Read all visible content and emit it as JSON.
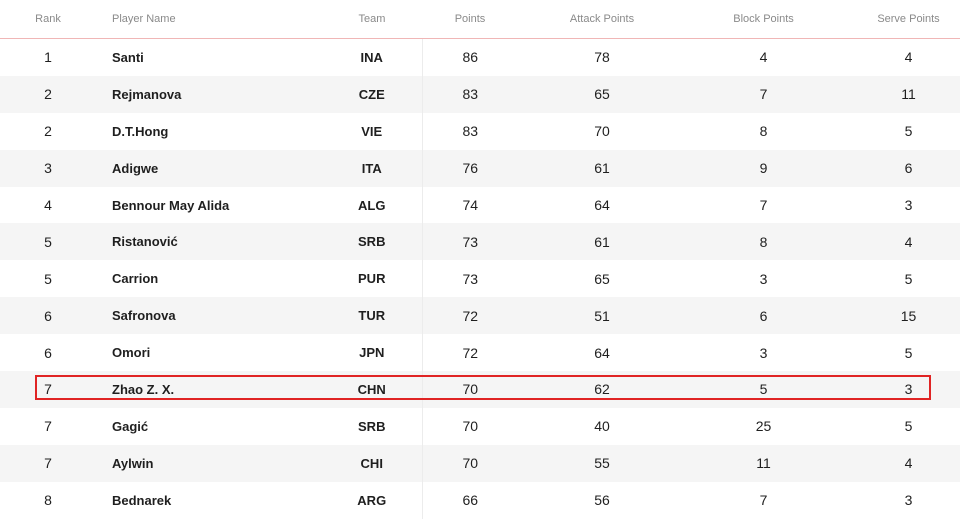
{
  "table": {
    "headers": {
      "rank": "Rank",
      "player": "Player Name",
      "team": "Team",
      "points": "Points",
      "attack": "Attack Points",
      "block": "Block Points",
      "serve": "Serve Points"
    },
    "rows": [
      {
        "rank": "1",
        "player": "Santi",
        "team": "INA",
        "points": "86",
        "attack": "78",
        "block": "4",
        "serve": "4"
      },
      {
        "rank": "2",
        "player": "Rejmanova",
        "team": "CZE",
        "points": "83",
        "attack": "65",
        "block": "7",
        "serve": "11"
      },
      {
        "rank": "2",
        "player": "D.T.Hong",
        "team": "VIE",
        "points": "83",
        "attack": "70",
        "block": "8",
        "serve": "5"
      },
      {
        "rank": "3",
        "player": "Adigwe",
        "team": "ITA",
        "points": "76",
        "attack": "61",
        "block": "9",
        "serve": "6"
      },
      {
        "rank": "4",
        "player": "Bennour May Alida",
        "team": "ALG",
        "points": "74",
        "attack": "64",
        "block": "7",
        "serve": "3"
      },
      {
        "rank": "5",
        "player": "Ristanović",
        "team": "SRB",
        "points": "73",
        "attack": "61",
        "block": "8",
        "serve": "4"
      },
      {
        "rank": "5",
        "player": "Carrion",
        "team": "PUR",
        "points": "73",
        "attack": "65",
        "block": "3",
        "serve": "5"
      },
      {
        "rank": "6",
        "player": "Safronova",
        "team": "TUR",
        "points": "72",
        "attack": "51",
        "block": "6",
        "serve": "15"
      },
      {
        "rank": "6",
        "player": "Omori",
        "team": "JPN",
        "points": "72",
        "attack": "64",
        "block": "3",
        "serve": "5"
      },
      {
        "rank": "7",
        "player": "Zhao Z. X.",
        "team": "CHN",
        "points": "70",
        "attack": "62",
        "block": "5",
        "serve": "3"
      },
      {
        "rank": "7",
        "player": "Gagić",
        "team": "SRB",
        "points": "70",
        "attack": "40",
        "block": "25",
        "serve": "5"
      },
      {
        "rank": "7",
        "player": "Aylwin",
        "team": "CHI",
        "points": "70",
        "attack": "55",
        "block": "11",
        "serve": "4"
      },
      {
        "rank": "8",
        "player": "Bednarek",
        "team": "ARG",
        "points": "66",
        "attack": "56",
        "block": "7",
        "serve": "3"
      }
    ]
  },
  "colors": {
    "highlight": "#e02424",
    "header_rule": "#f0b6b6",
    "stripe": "#f5f5f5"
  }
}
